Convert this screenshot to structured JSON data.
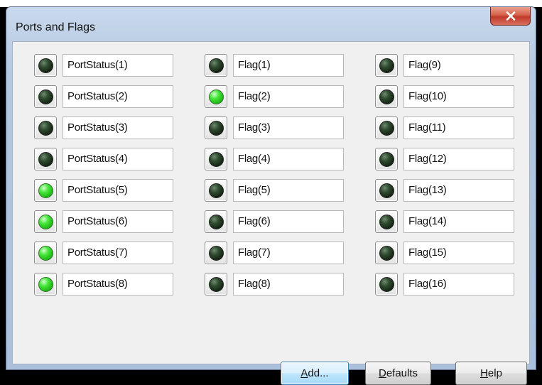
{
  "window": {
    "title": "Ports and Flags",
    "close_label": "X"
  },
  "colors": {
    "led_on": "#33dd2a",
    "led_off": "#1f3a1f",
    "default_button_border": "#3c7fb1",
    "close_button": "#c0392b"
  },
  "columns": [
    {
      "items": [
        {
          "label": "PortStatus(1)",
          "on": false
        },
        {
          "label": "PortStatus(2)",
          "on": false
        },
        {
          "label": "PortStatus(3)",
          "on": false
        },
        {
          "label": "PortStatus(4)",
          "on": false
        },
        {
          "label": "PortStatus(5)",
          "on": true
        },
        {
          "label": "PortStatus(6)",
          "on": true
        },
        {
          "label": "PortStatus(7)",
          "on": true
        },
        {
          "label": "PortStatus(8)",
          "on": true
        }
      ]
    },
    {
      "items": [
        {
          "label": "Flag(1)",
          "on": false
        },
        {
          "label": "Flag(2)",
          "on": true
        },
        {
          "label": "Flag(3)",
          "on": false
        },
        {
          "label": "Flag(4)",
          "on": false
        },
        {
          "label": "Flag(5)",
          "on": false
        },
        {
          "label": "Flag(6)",
          "on": false
        },
        {
          "label": "Flag(7)",
          "on": false
        },
        {
          "label": "Flag(8)",
          "on": false
        }
      ]
    },
    {
      "items": [
        {
          "label": "Flag(9)",
          "on": false
        },
        {
          "label": "Flag(10)",
          "on": false
        },
        {
          "label": "Flag(11)",
          "on": false
        },
        {
          "label": "Flag(12)",
          "on": false
        },
        {
          "label": "Flag(13)",
          "on": false
        },
        {
          "label": "Flag(14)",
          "on": false
        },
        {
          "label": "Flag(15)",
          "on": false
        },
        {
          "label": "Flag(16)",
          "on": false
        }
      ]
    }
  ],
  "buttons": {
    "add": {
      "prefix": "",
      "mnemonic": "A",
      "rest": "dd..."
    },
    "defaults": {
      "prefix": "",
      "mnemonic": "D",
      "rest": "efaults"
    },
    "help": {
      "prefix": "",
      "mnemonic": "H",
      "rest": "elp"
    }
  }
}
